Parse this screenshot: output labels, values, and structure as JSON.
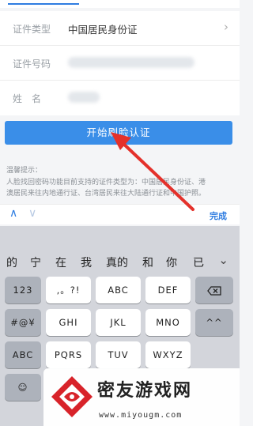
{
  "form": {
    "id_type_label": "证件类型",
    "id_type_value": "中国居民身份证",
    "id_number_label": "证件号码",
    "name_label": "姓　名"
  },
  "start_button_label": "开始刷脸认证",
  "tips": {
    "title": "温馨提示：",
    "line1": "人脸找回密码功能目前支持的证件类型为：中国居民身份证、港",
    "line2": "澳居民来往内地通行证、台湾居民来往大陆通行证和中国护照。"
  },
  "accessory": {
    "up_icon": "chevron-up-icon",
    "down_icon": "chevron-down-icon",
    "done_label": "完成"
  },
  "keyboard": {
    "candidates": [
      "的",
      "宁",
      "在",
      "我",
      "真的",
      "和",
      "你",
      "已"
    ],
    "left_column": [
      "123",
      "#@¥",
      "ABC",
      "☺"
    ],
    "rows": [
      [
        ",。?!",
        "ABC",
        "DEF"
      ],
      [
        "GHI",
        "JKL",
        "MNO"
      ],
      [
        "PQRS",
        "TUV",
        "WXYZ"
      ]
    ],
    "delete_icon": "backspace-icon",
    "caret_key": "^^"
  },
  "watermark": {
    "title": "密友游戏网",
    "url": "www.miyougm.com"
  }
}
